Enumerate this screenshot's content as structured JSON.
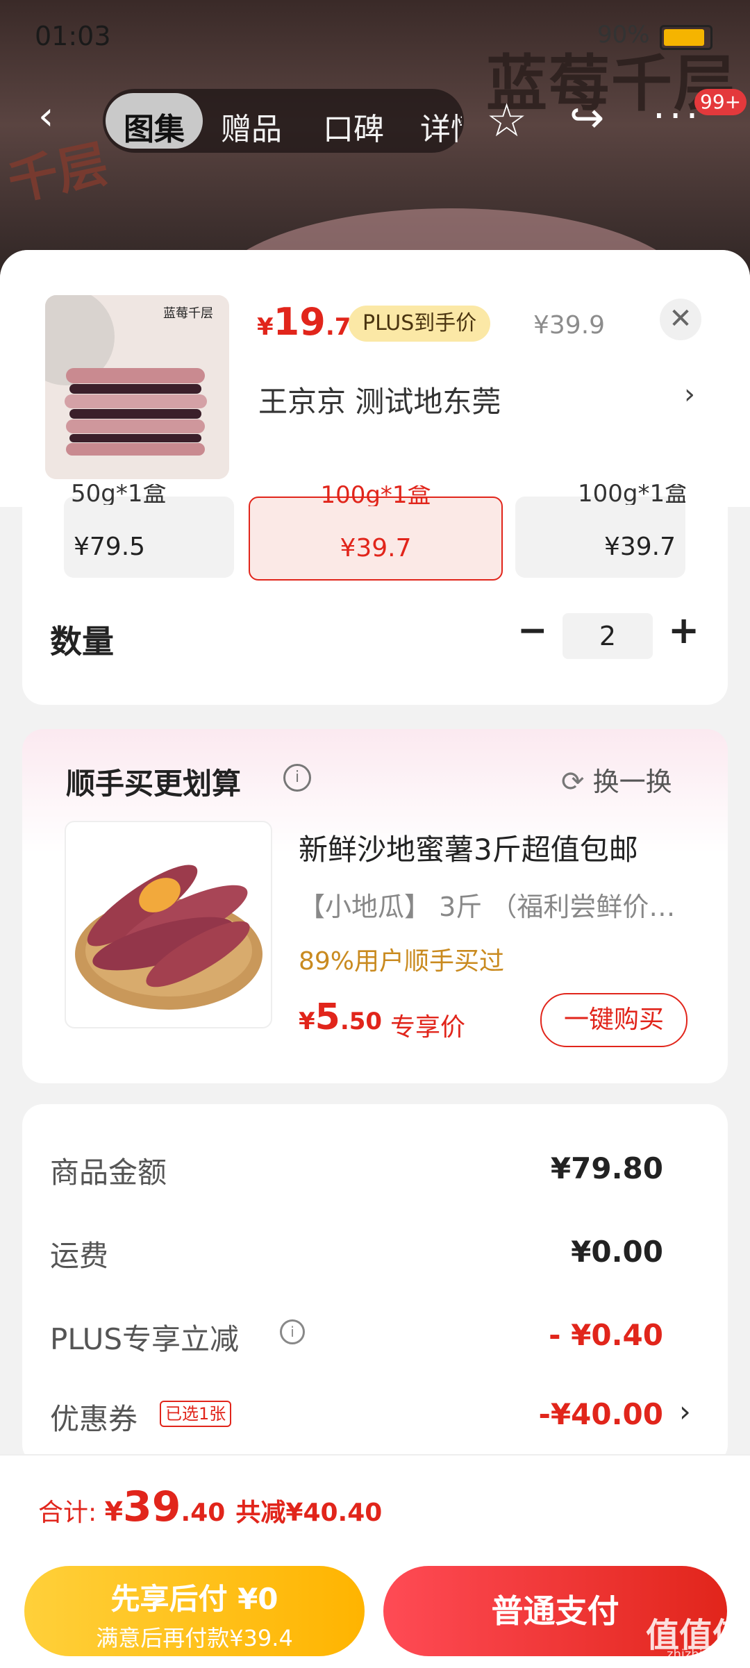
{
  "status": {
    "time": "01:03",
    "battery": "90%"
  },
  "header": {
    "tabs": [
      "图集",
      "赠品",
      "口碑",
      "详情"
    ],
    "badge": "99+",
    "bg_title": "蓝莓千层",
    "bg_side_text": "千层"
  },
  "product": {
    "thumb_label": "蓝莓千层",
    "price_symbol": "¥",
    "price_int": "19",
    "price_dec": ".7",
    "plus_label": "PLUS到手价",
    "orig_price": "¥39.9",
    "address": "王京京  测试地东莞"
  },
  "specs": [
    {
      "top": "50g*1盒",
      "price": "¥79.5"
    },
    {
      "top": "100g*1盒",
      "price": "¥39.7"
    },
    {
      "top": "100g*1盒",
      "price": "¥39.7"
    }
  ],
  "quantity": {
    "label": "数量",
    "value": "2"
  },
  "addon": {
    "title": "顺手买更划算",
    "swap": "换一换",
    "name": "新鲜沙地蜜薯3斤超值包邮",
    "spec": "【小地瓜】 3斤 （福利尝鲜价…",
    "social": "89%用户顺手买过",
    "price_symbol": "¥",
    "price_int": "5",
    "price_dec": ".50",
    "price_tag": "专享价",
    "buy": "一键购买"
  },
  "summary": {
    "rows": [
      {
        "label": "商品金额",
        "value": "¥79.80"
      },
      {
        "label": "运费",
        "value": "¥0.00"
      },
      {
        "label": "PLUS专享立减",
        "value": "- ¥0.40"
      },
      {
        "label": "优惠券",
        "value": "-¥40.00"
      }
    ],
    "coupon_badge": "已选1张"
  },
  "footer": {
    "total_label": "合计: ",
    "total_symbol": "¥",
    "total_int": "39",
    "total_dec": ".40",
    "saved": "共减¥40.40",
    "later_line1": "先享后付 ¥0",
    "later_line2": "满意后再付款¥39.4",
    "pay": "普通支付"
  },
  "watermark": {
    "main": "值值值",
    "sub": "zhizhizhi.com"
  },
  "colors": {
    "accent": "#e1251b",
    "plus_pill": "#fbe8a6",
    "later_button": "#ffc21a"
  }
}
